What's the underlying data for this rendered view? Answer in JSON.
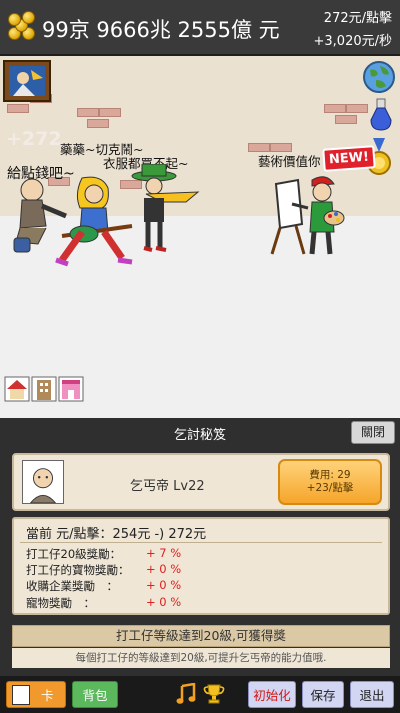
{
  "header": {
    "money": "99京 9666兆 2555億 元",
    "per_click": "272元/點擊",
    "per_second": "+3,020元/秒"
  },
  "scene": {
    "floating_value": "+272",
    "beggar_speech": "給點錢吧~",
    "guitarist_speech_1": "藥藥~切克鬧~",
    "guitarist_speech_2": "衣服都買不起~",
    "painter_speech": "藝術價值你",
    "new_badge": "NEW!"
  },
  "panel": {
    "title": "乞討秘笈",
    "close_label": "關閉",
    "character_name": "乞丐帝 Lv22",
    "upgrade_cost": "費用: 29",
    "upgrade_gain": "+23/點擊",
    "current_label": "當前 元/點擊：254元 -) 272元",
    "stats": [
      {
        "label": "打工仔20級獎勵：",
        "value": "+ 7 %"
      },
      {
        "label": "打工仔的寶物獎勵：",
        "value": "+ 0 %"
      },
      {
        "label": "收購企業獎勵　：",
        "value": "+ 0 %"
      },
      {
        "label": "寵物獎勵　：",
        "value": "+ 0 %"
      }
    ],
    "bonus_title": "打工仔等級達到20級,可獲得獎",
    "bonus_desc": "每個打工仔的等級達到20級,可提升乞丐帝的能力值哦."
  },
  "bottom": {
    "card_label": "卡",
    "bag_label": "背包",
    "reset_label": "初始化",
    "save_label": "保存",
    "exit_label": "退出"
  },
  "colors": {
    "upgrade_button": "#f5a52a",
    "stat_value": "#e02020",
    "reset_text": "#d01818"
  }
}
